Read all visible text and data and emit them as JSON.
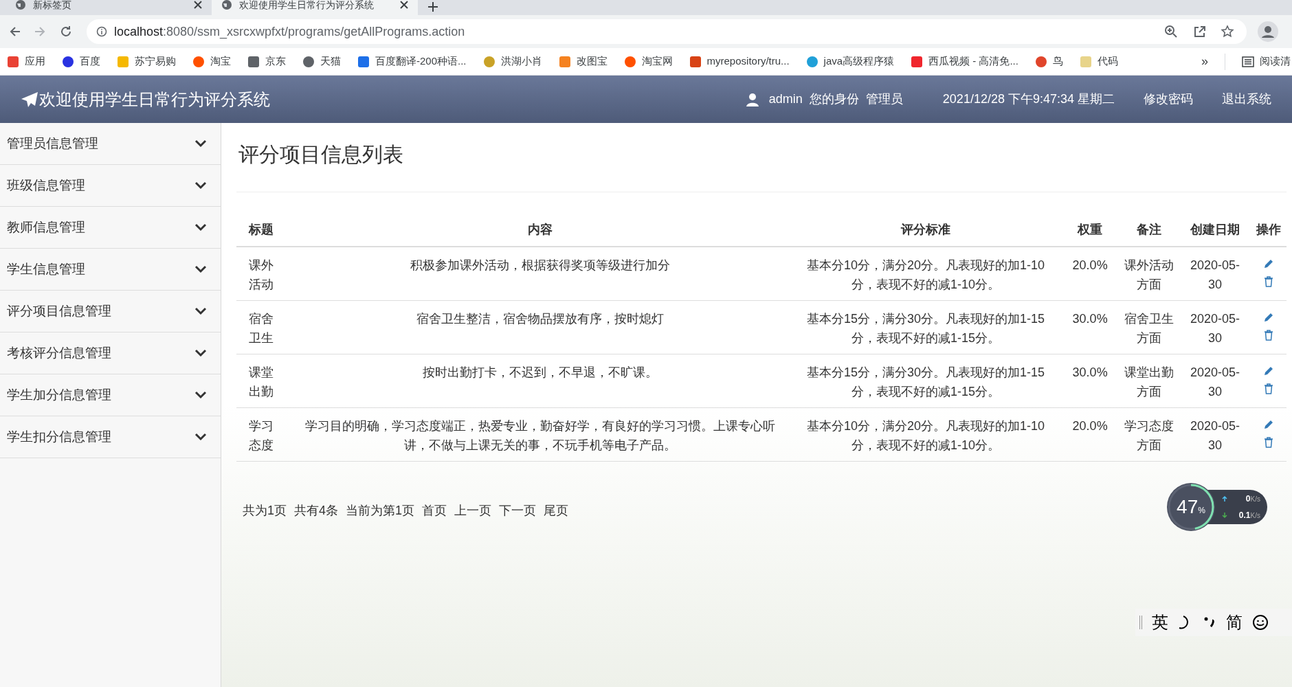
{
  "browser": {
    "tabs": [
      {
        "title": "新标签页",
        "selected": false
      },
      {
        "title": "欢迎使用学生日常行为评分系统",
        "selected": true
      }
    ],
    "url_host": "localhost",
    "url_path": ":8080/ssm_xsrcxwpfxt/programs/getAllPrograms.action",
    "bookmarks": [
      {
        "label": "应用",
        "color": "#e94235"
      },
      {
        "label": "百度",
        "color": "#2932e1"
      },
      {
        "label": "苏宁易购",
        "color": "#f5b800"
      },
      {
        "label": "淘宝",
        "color": "#ff5000"
      },
      {
        "label": "京东",
        "color": "#5f6368"
      },
      {
        "label": "天猫",
        "color": "#5f6368"
      },
      {
        "label": "百度翻译-200种语...",
        "color": "#1d6fe8"
      },
      {
        "label": "洪湖小肖",
        "color": "#c9a227"
      },
      {
        "label": "改图宝",
        "color": "#f58220"
      },
      {
        "label": "淘宝网",
        "color": "#ff5000"
      },
      {
        "label": "myrepository/tru...",
        "color": "#d84315"
      },
      {
        "label": "java高级程序猿",
        "color": "#20a0d8"
      },
      {
        "label": "西瓜视频 - 高清免...",
        "color": "#f0262d"
      },
      {
        "label": "鸟",
        "color": "#e0452b"
      },
      {
        "label": "代码",
        "color": "#e8d48a"
      }
    ],
    "more": "»",
    "reading_list": "阅读清"
  },
  "header": {
    "title": "欢迎使用学生日常行为评分系统",
    "user": "admin",
    "role_label": "您的身份",
    "role": "管理员",
    "datetime": "2021/12/28 下午9:47:34 星期二",
    "links": [
      "修改密码",
      "退出系统"
    ]
  },
  "sidebar": {
    "items": [
      {
        "label": "管理员信息管理",
        "expanded": false
      },
      {
        "label": "班级信息管理",
        "expanded": false
      },
      {
        "label": "教师信息管理",
        "expanded": false
      },
      {
        "label": "学生信息管理",
        "expanded": false
      },
      {
        "label": "评分项目信息管理",
        "expanded": false
      },
      {
        "label": "考核评分信息管理",
        "expanded": false
      },
      {
        "label": "学生加分信息管理",
        "expanded": false
      },
      {
        "label": "学生扣分信息管理",
        "expanded": false
      }
    ]
  },
  "page_title": "评分项目信息列表",
  "table": {
    "columns": [
      "标题",
      "内容",
      "评分标准",
      "权重",
      "备注",
      "创建日期",
      "操作"
    ],
    "rows": [
      [
        "课外活动",
        "积极参加课外活动，根据获得奖项等级进行加分",
        "基本分10分，满分20分。凡表现好的加1-10分，表现不好的减1-10分。",
        "20.0%",
        "课外活动方面",
        "2020-05-30"
      ],
      [
        "宿舍卫生",
        "宿舍卫生整洁，宿舍物品摆放有序，按时熄灯",
        "基本分15分，满分30分。凡表现好的加1-15分，表现不好的减1-15分。",
        "30.0%",
        "宿舍卫生方面",
        "2020-05-30"
      ],
      [
        "课堂出勤",
        "按时出勤打卡，不迟到，不早退，不旷课。",
        "基本分15分，满分30分。凡表现好的加1-15分，表现不好的减1-15分。",
        "30.0%",
        "课堂出勤方面",
        "2020-05-30"
      ],
      [
        "学习态度",
        "学习目的明确，学习态度端正，热爱专业，勤奋好学，有良好的学习习惯。上课专心听讲，不做与上课无关的事，不玩手机等电子产品。",
        "基本分10分，满分20分。凡表现好的加1-10分，表现不好的减1-10分。",
        "20.0%",
        "学习态度方面",
        "2020-05-30"
      ]
    ]
  },
  "pagination": [
    "共为1页",
    "共有4条",
    "当前为第1页",
    "首页",
    "上一页",
    "下一页",
    "尾页"
  ],
  "speed_widget": {
    "level": 0.47,
    "percent": "47",
    "percent_sign": "%",
    "up": "0",
    "up_unit": "K/s",
    "down": "0.1",
    "down_unit": "K/s"
  },
  "ime_toolbar": {
    "lang": "英",
    "mode": "简"
  }
}
